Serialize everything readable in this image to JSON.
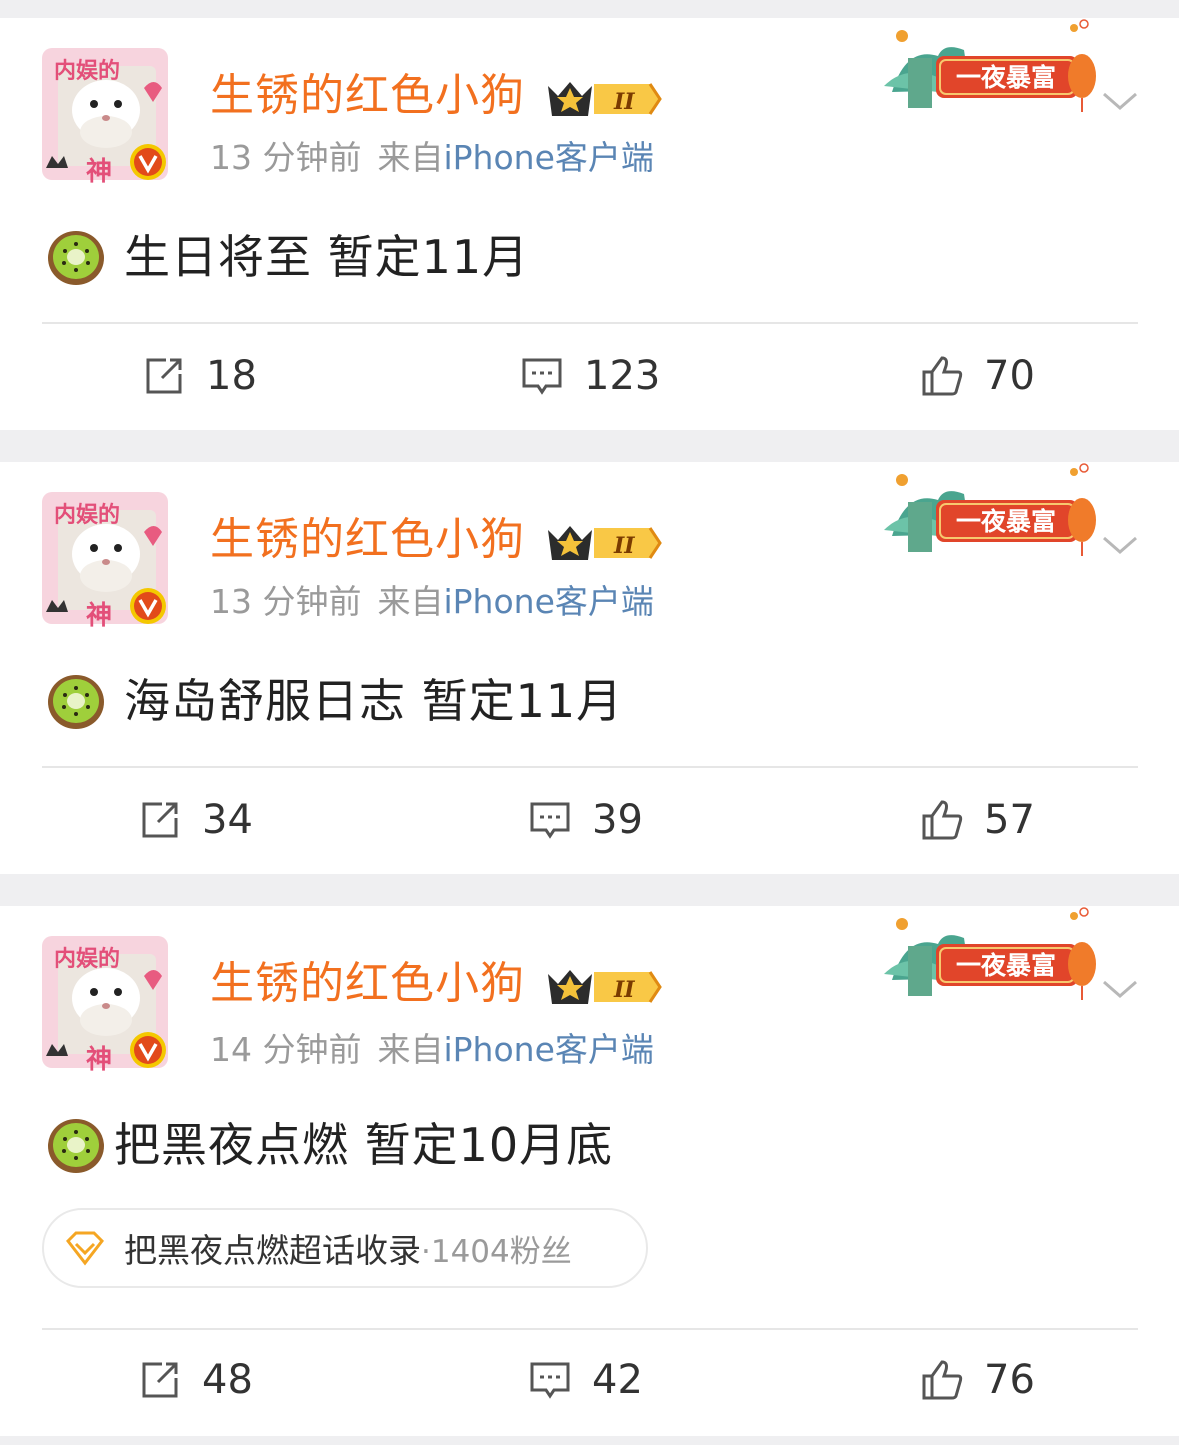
{
  "colors": {
    "username": "#f2701f",
    "meta": "#9a9a9a",
    "device": "#5a85b4",
    "background": "#efeff1"
  },
  "badge_text": "一夜暴富",
  "avatar_text": {
    "top": "内娱的",
    "bottom": "神"
  },
  "crown_level": "II",
  "posts": [
    {
      "username": "生锈的红色小狗",
      "time": "13 分钟前",
      "source_prefix": "来自",
      "device": "iPhone客户端",
      "content": "生日将至 暂定11月",
      "repost": "18",
      "comment": "123",
      "like": "70"
    },
    {
      "username": "生锈的红色小狗",
      "time": "13 分钟前",
      "source_prefix": "来自",
      "device": "iPhone客户端",
      "content": "海岛舒服日志 暂定11月",
      "repost": "34",
      "comment": "39",
      "like": "57"
    },
    {
      "username": "生锈的红色小狗",
      "time": "14 分钟前",
      "source_prefix": "来自",
      "device": "iPhone客户端",
      "content": "把黑夜点燃 暂定10月底",
      "topic_name": "把黑夜点燃超话收录",
      "topic_fans": "·1404粉丝",
      "repost": "48",
      "comment": "42",
      "like": "76"
    }
  ]
}
